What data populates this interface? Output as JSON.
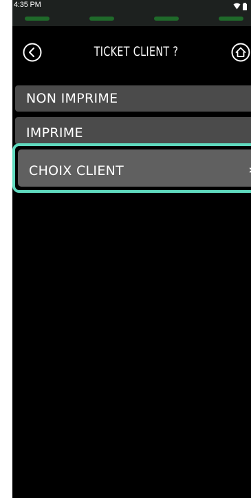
{
  "status_bar": {
    "time": "4:35 PM"
  },
  "header": {
    "title": "TICKET CLIENT ?",
    "back_icon": "circle-chevron-left-icon",
    "home_icon": "circle-home-icon"
  },
  "options": [
    {
      "label": "NON IMPRIME"
    },
    {
      "label": "IMPRIME"
    },
    {
      "label": "CHOIX CLIENT",
      "selected": true
    }
  ],
  "colors": {
    "background": "#000000",
    "option_bg": "#4b4b4b",
    "selected_option_bg": "#606060",
    "selection_border": "#5fd9be",
    "status_light": "#1f6a2a"
  }
}
